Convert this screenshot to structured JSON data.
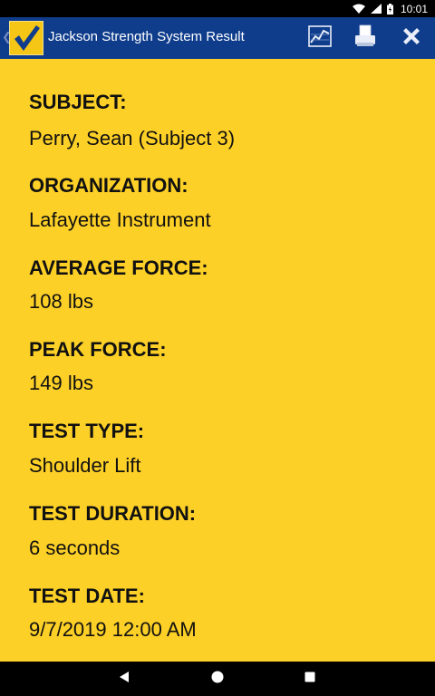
{
  "status_bar": {
    "time": "10:01",
    "icons": [
      "wifi-icon",
      "signal-icon",
      "battery-icon"
    ]
  },
  "app_bar": {
    "title": "Jackson Strength System Result",
    "logo_icon": "checkmark-logo-icon",
    "actions": [
      "chart-icon",
      "print-icon",
      "close-icon"
    ]
  },
  "result": {
    "fields": [
      {
        "label": "SUBJECT:",
        "value": "Perry, Sean (Subject 3)"
      },
      {
        "label": "ORGANIZATION:",
        "value": "Lafayette Instrument"
      },
      {
        "label": "AVERAGE FORCE:",
        "value": "108 lbs"
      },
      {
        "label": "PEAK FORCE:",
        "value": "149 lbs"
      },
      {
        "label": "TEST TYPE:",
        "value": "Shoulder Lift"
      },
      {
        "label": "TEST DURATION:",
        "value": "6 seconds"
      },
      {
        "label": "TEST DATE:",
        "value": "9/7/2019 12:00 AM"
      }
    ]
  },
  "nav_bar": {
    "buttons": [
      "back-icon",
      "home-icon",
      "recents-icon"
    ]
  },
  "colors": {
    "app_bar": "#0f3d8c",
    "content_bg": "#fdd027",
    "logo_bg": "#f6c616",
    "text": "#111111"
  }
}
